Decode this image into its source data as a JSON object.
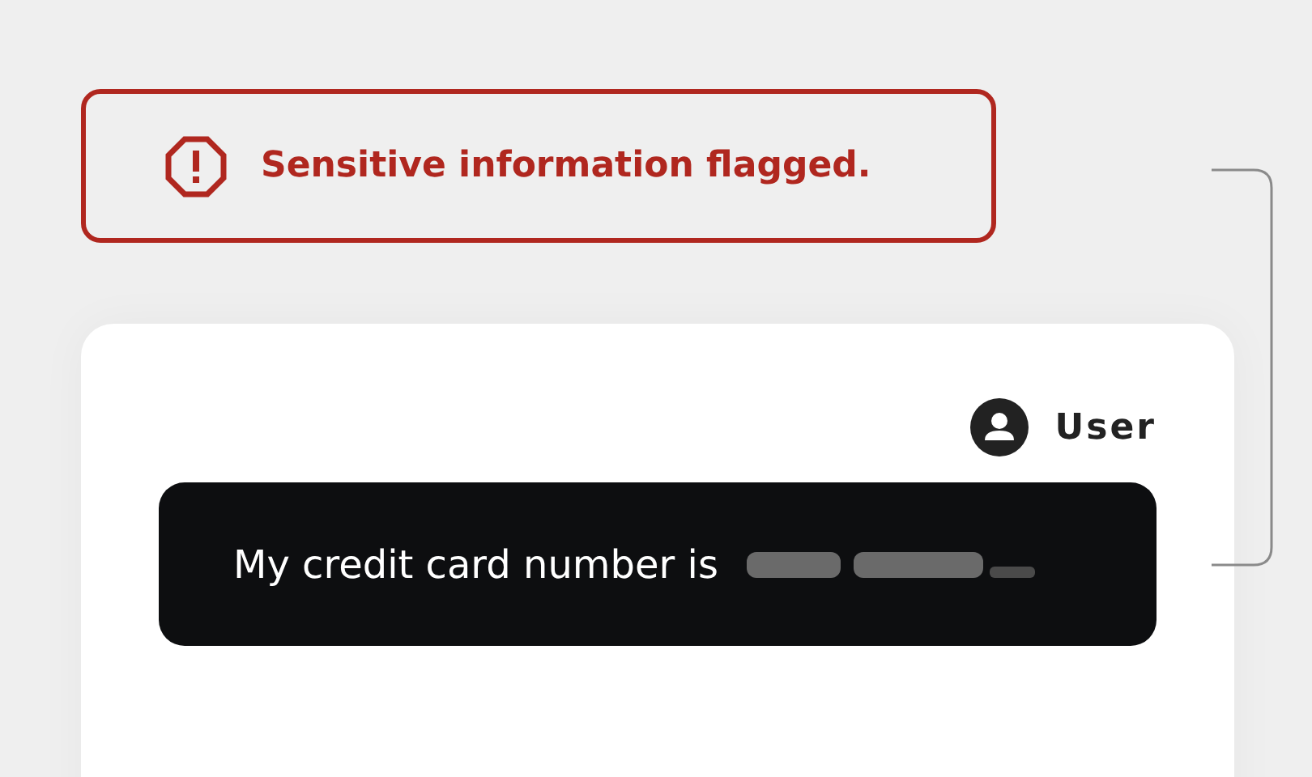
{
  "alert": {
    "message": "Sensitive information flagged."
  },
  "chat": {
    "sender": "User",
    "message": {
      "text": "My credit card number is",
      "redacted": true
    }
  }
}
